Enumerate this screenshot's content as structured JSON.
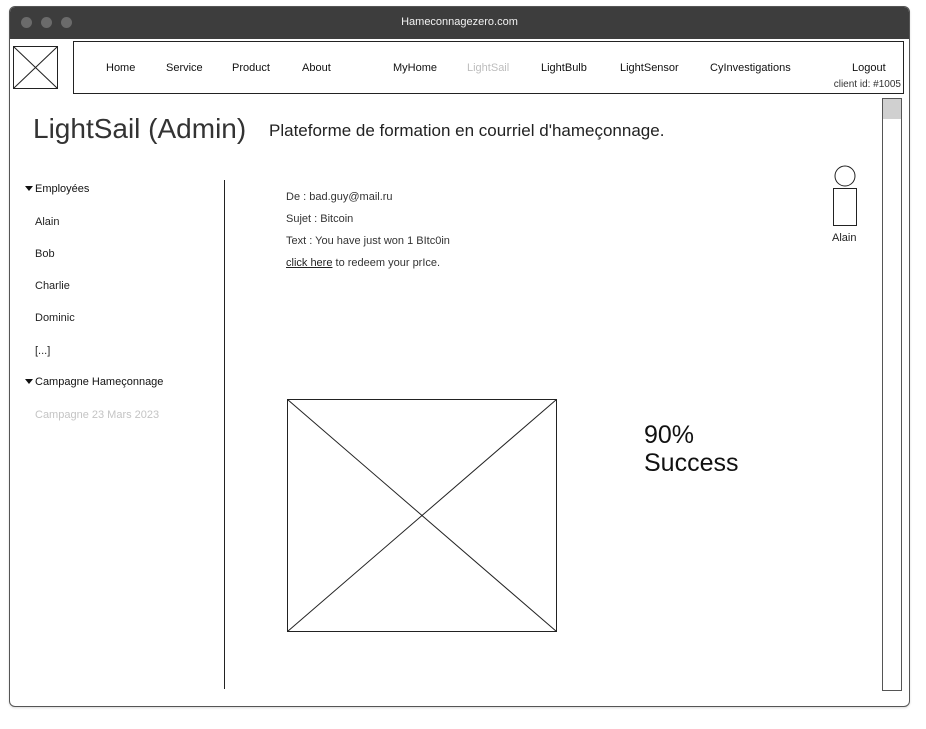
{
  "window": {
    "title": "Hameconnagezero.com"
  },
  "nav": {
    "items": [
      "Home",
      "Service",
      "Product",
      "About",
      "MyHome",
      "LightSail",
      "LightBulb",
      "LightSensor",
      "CyInvestigations"
    ],
    "active": "LightSail",
    "logout_label": "Logout",
    "client_id": "client id: #1005"
  },
  "header": {
    "title": "LightSail (Admin)",
    "subtitle": "Plateforme de formation en courriel d'hameçonnage."
  },
  "sidebar": {
    "employees_label": "Employées",
    "employees": [
      "Alain",
      "Bob",
      "Charlie",
      "Dominic",
      "[...]"
    ],
    "campaign_label": "Campagne Hameçonnage",
    "campaigns": [
      "Campagne 23 Mars 2023"
    ]
  },
  "email": {
    "from": "De : bad.guy@mail.ru",
    "subject": "Sujet : Bitcoin",
    "text": "Text : You have just won 1 BItc0in",
    "link_label": "click here",
    "link_suffix": " to redeem your prIce."
  },
  "user": {
    "name": "Alain"
  },
  "stats": {
    "percent": "90%",
    "label": "Success"
  },
  "colors": {
    "titlebar": "#3d3d3d",
    "active_nav": "#bdbdbd",
    "disabled_item": "#c4c4c4"
  },
  "icons": [
    "logo-placeholder-icon",
    "user-avatar-icon",
    "image-placeholder-icon",
    "caret-down-icon"
  ]
}
